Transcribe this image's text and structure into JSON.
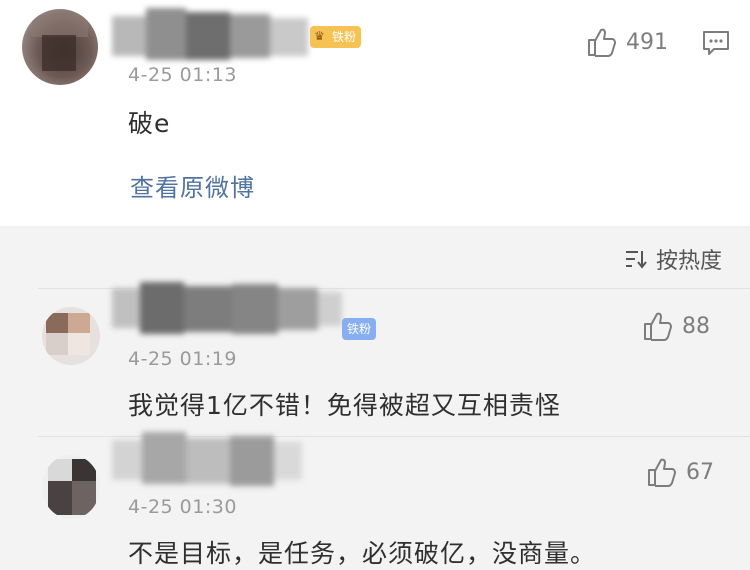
{
  "main_comment": {
    "badge": "铁粉",
    "time": "4-25 01:13",
    "text": "破e",
    "likes": "491",
    "view_original": "查看原微博"
  },
  "sort": {
    "label": "按热度",
    "icon": "sort-icon"
  },
  "replies": [
    {
      "badge": "铁粉",
      "time": "4-25 01:19",
      "text": "我觉得1亿不错！免得被超又互相责怪",
      "likes": "88"
    },
    {
      "time": "4-25 01:30",
      "text": "不是目标，是任务，必须破亿，没商量。",
      "likes": "67"
    }
  ],
  "colors": {
    "link": "#50739f",
    "badge_gold": "#f6c253",
    "badge_blue": "#86aef0",
    "time": "#9a9a9a"
  }
}
